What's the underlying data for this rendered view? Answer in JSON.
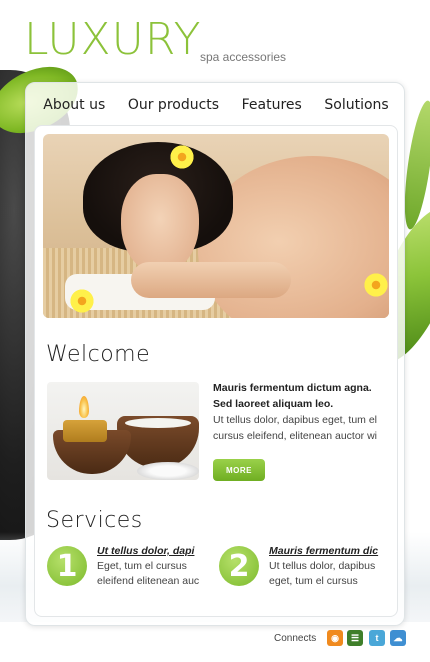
{
  "header": {
    "logo": "LUXURY",
    "tagline": "spa accessories"
  },
  "nav": {
    "items": [
      {
        "label": "About us"
      },
      {
        "label": "Our products"
      },
      {
        "label": "Features"
      },
      {
        "label": "Solutions"
      }
    ]
  },
  "welcome": {
    "title": "Welcome",
    "headline_1": "Mauris fermentum dictum agna.",
    "headline_2": "Sed laoreet aliquam leo.",
    "body_1": "Ut tellus dolor, dapibus eget, tum el",
    "body_2": "cursus eleifend, elitenean auctor wi",
    "more_label": "MORE"
  },
  "services": {
    "title": "Services",
    "items": [
      {
        "number": "1",
        "title": "Ut tellus dolor, dapi",
        "line_1": "Eget, tum el cursus",
        "line_2": "eleifend elitenean auc"
      },
      {
        "number": "2",
        "title": "Mauris fermentum dic",
        "line_1": "Ut tellus dolor, dapibus",
        "line_2": "eget, tum el cursus"
      }
    ]
  },
  "footer": {
    "connects_label": "Connects",
    "social_icons": [
      "rss-icon",
      "evernote-icon",
      "twitter-icon",
      "cloud-icon"
    ]
  },
  "colors": {
    "accent": "#8cc23a",
    "button": "#7cba2c"
  }
}
